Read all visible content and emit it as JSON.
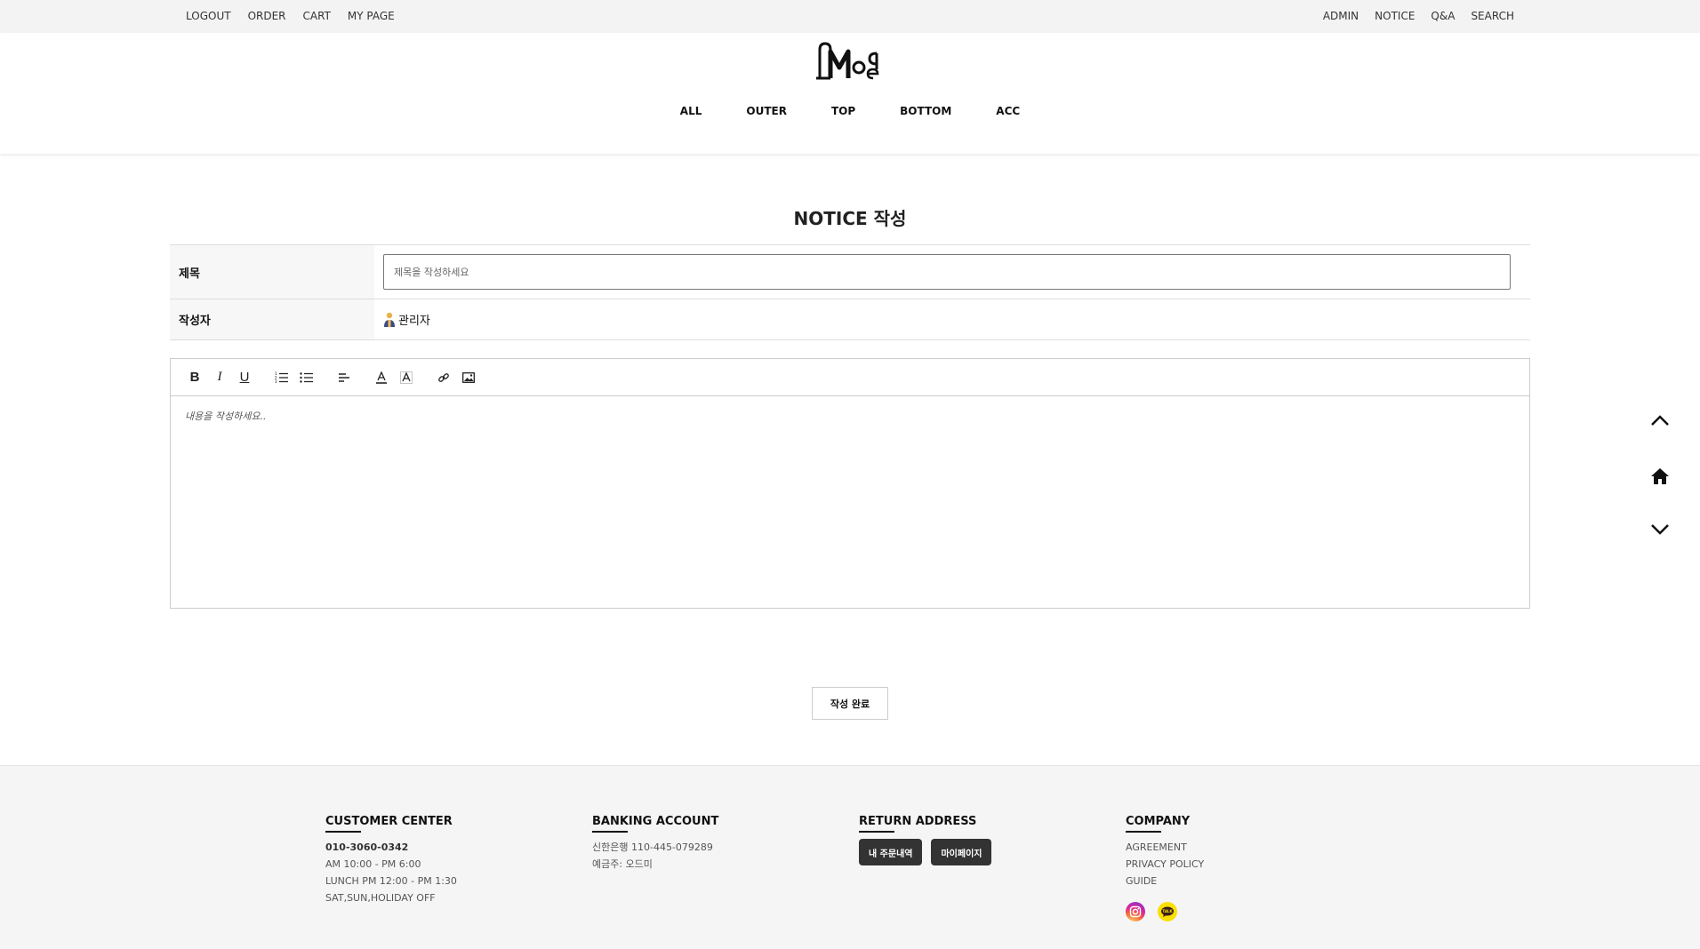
{
  "topbar": {
    "left": [
      "LOGOUT",
      "ORDER",
      "CART",
      "MY PAGE"
    ],
    "right": [
      "ADMIN",
      "NOTICE",
      "Q&A",
      "SEARCH"
    ]
  },
  "nav": [
    "ALL",
    "OUTER",
    "TOP",
    "BOTTOM",
    "ACC"
  ],
  "page_title": "NOTICE 작성",
  "form": {
    "title_label": "제목",
    "title_placeholder": "제목을 작성하세요",
    "writer_label": "작성자",
    "writer_value": "관리자"
  },
  "editor": {
    "placeholder": "내용을 작성하세요..",
    "toolbar": [
      "bold-icon",
      "italic-icon",
      "underline-icon",
      "ordered-list-icon",
      "bullet-list-icon",
      "align-icon",
      "text-color-icon",
      "background-color-icon",
      "link-icon",
      "image-icon"
    ]
  },
  "submit_label": "작성 완료",
  "footer": {
    "customer": {
      "heading": "CUSTOMER CENTER",
      "phone": "010-3060-0342",
      "hours": "AM 10:00 - PM 6:00",
      "lunch": "LUNCH PM 12:00 - PM 1:30",
      "off": "SAT,SUN,HOLIDAY OFF"
    },
    "banking": {
      "heading": "BANKING ACCOUNT",
      "account": "신한은행 110-445-079289",
      "holder": "예금주: 오드미"
    },
    "return": {
      "heading": "RETURN ADDRESS",
      "btn_orders": "내 주문내역",
      "btn_mypage": "마이페이지"
    },
    "company": {
      "heading": "COMPANY",
      "links": [
        "AGREEMENT",
        "PRIVACY POLICY",
        "GUIDE"
      ]
    }
  },
  "colors": {
    "topbar_bg": "#f3f3f3",
    "footer_bg": "#f5f5f5",
    "button_dark": "#333333",
    "kakao_yellow": "#f9e000"
  }
}
